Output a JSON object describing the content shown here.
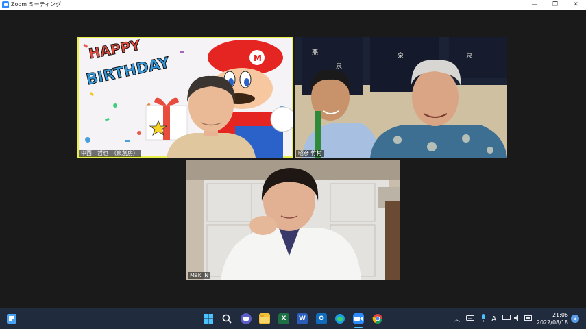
{
  "window": {
    "title": "Zoom ミーティング",
    "minimize": "—",
    "restore": "❐",
    "close": "✕"
  },
  "participants": [
    {
      "name": "中西　哲也　（泉創房）",
      "active_speaker": true
    },
    {
      "name": "昭彦 竹村",
      "active_speaker": false
    },
    {
      "name": "Maki N",
      "active_speaker": false
    }
  ],
  "banner": {
    "line1": "HAPPY",
    "line2": "BIRTHDAY"
  },
  "taskbar": {
    "clock_time": "21:06",
    "clock_date": "2022/08/18",
    "notification_count": "3",
    "ime_indicator": "A"
  },
  "colors": {
    "taskbar_bg": "#202b3e",
    "active_outline": "#e8ef4a",
    "zoom_blue": "#2d8cff"
  }
}
